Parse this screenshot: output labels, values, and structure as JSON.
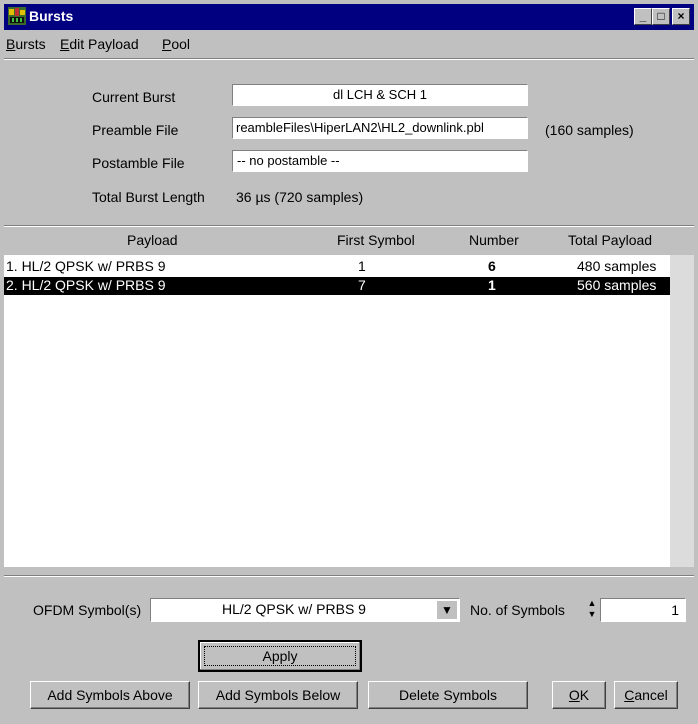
{
  "window": {
    "title": "Bursts"
  },
  "menu": [
    {
      "label": "Bursts",
      "mnemonic": "B",
      "rest": "ursts"
    },
    {
      "label": "Edit Payload",
      "mnemonic": "E",
      "rest": "dit Payload"
    },
    {
      "label": "Pool",
      "mnemonic": "P",
      "rest": "ool"
    }
  ],
  "form": {
    "current_burst_label": "Current Burst",
    "current_burst_value": "dl LCH & SCH 1",
    "preamble_label": "Preamble File",
    "preamble_value": "reambleFiles\\HiperLAN2\\HL2_downlink.pbl",
    "preamble_samples": "(160 samples)",
    "postamble_label": "Postamble File",
    "postamble_value": "-- no postamble --",
    "total_label": "Total Burst Length",
    "total_value": "36 µs  (720 samples)"
  },
  "table": {
    "headers": [
      "Payload",
      "First Symbol",
      "Number",
      "Total Payload"
    ],
    "rows": [
      {
        "payload": "1. HL/2 QPSK w/ PRBS 9",
        "first": "1",
        "number": "6",
        "total": "480 samples",
        "selected": false
      },
      {
        "payload": "2. HL/2 QPSK w/ PRBS 9",
        "first": "7",
        "number": "1",
        "total": "560 samples",
        "selected": true
      }
    ]
  },
  "controls": {
    "ofdm_label": "OFDM Symbol(s)",
    "ofdm_value": "HL/2 QPSK w/ PRBS 9",
    "num_symbols_label": "No. of Symbols",
    "num_symbols_value": "1",
    "apply": "Apply",
    "add_above": "Add Symbols Above",
    "add_below": "Add Symbols Below",
    "delete": "Delete Symbols",
    "ok_m": "O",
    "ok_rest": "K",
    "cancel_m": "C",
    "cancel_rest": "ancel"
  }
}
